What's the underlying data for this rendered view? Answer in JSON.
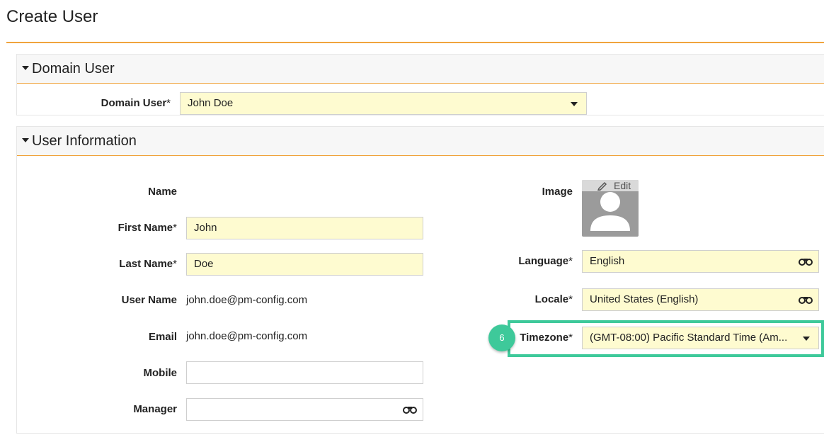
{
  "page": {
    "title": "Create User"
  },
  "domain_section": {
    "title": "Domain User",
    "domain_user_label": "Domain User",
    "required_mark": "*",
    "domain_user_value": "John Doe"
  },
  "user_info_section": {
    "title": "User Information",
    "name_label": "Name",
    "first_name_label": "First Name",
    "first_name_value": "John",
    "last_name_label": "Last Name",
    "last_name_value": "Doe",
    "user_name_label": "User Name",
    "user_name_value": "john.doe@pm-config.com",
    "email_label": "Email",
    "email_value": "john.doe@pm-config.com",
    "mobile_label": "Mobile",
    "mobile_value": "",
    "manager_label": "Manager",
    "manager_value": "",
    "image_label": "Image",
    "image_edit_label": "Edit",
    "language_label": "Language",
    "language_value": "English",
    "locale_label": "Locale",
    "locale_value": "United States (English)",
    "timezone_label": "Timezone",
    "timezone_value": "(GMT-08:00) Pacific Standard Time (Am...",
    "required_mark": "*"
  },
  "annotation": {
    "step_number": "6",
    "highlight_color": "#3ec99a"
  },
  "colors": {
    "accent": "#f0a33c",
    "field_bg": "#fefbd0"
  },
  "icons": {
    "section_toggle": "caret-down-icon",
    "dropdown": "chevron-down-icon",
    "lookup": "binoculars-icon",
    "edit": "pencil-icon",
    "avatar": "user-silhouette-icon"
  }
}
